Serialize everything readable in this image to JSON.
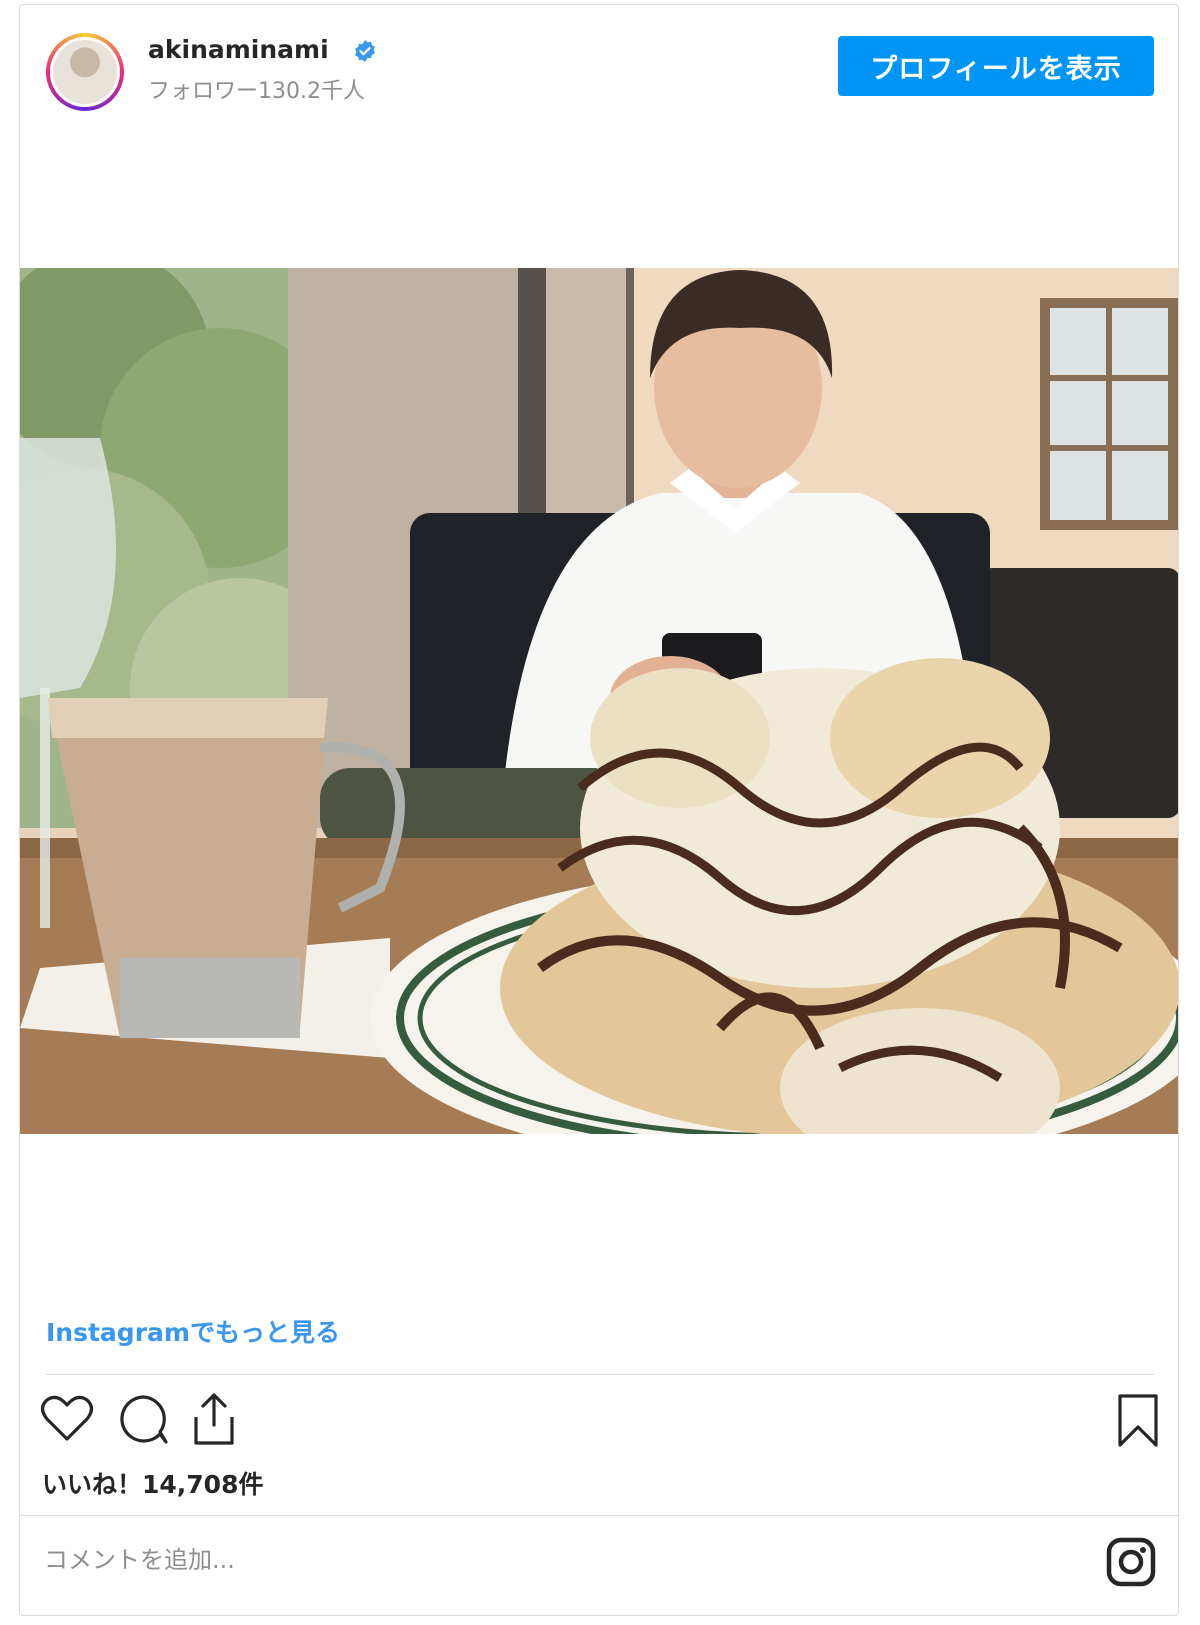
{
  "header": {
    "username": "akinaminami",
    "followers": "フォロワー130.2千人",
    "profile_button": "プロフィールを表示"
  },
  "post": {
    "more_link": "Instagramでもっと見る",
    "likes": "いいね！14,708件",
    "comment_placeholder": "コメントを追加...",
    "icons": [
      "heart-icon",
      "comment-icon",
      "share-icon",
      "bookmark-icon",
      "instagram-logo-icon",
      "verified-badge-icon"
    ]
  },
  "colors": {
    "accent": "#0095f6",
    "link": "#3897f0",
    "muted": "#8e8e8e",
    "border": "#dbdbdb"
  }
}
